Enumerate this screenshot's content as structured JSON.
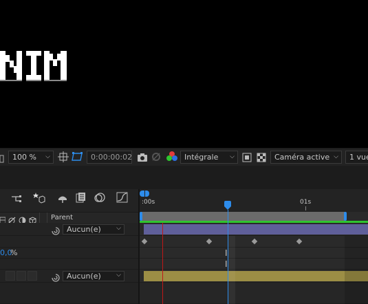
{
  "viewer": {
    "comp_text": "NIM"
  },
  "viewer_toolbar": {
    "zoom": "100 %",
    "timecode": "0:00:00:02",
    "resolution": "Intégrale",
    "camera": "Caméra active",
    "views": "1 vue"
  },
  "timeline": {
    "ruler": {
      "start_label": ":00s",
      "mark_label": "01s"
    },
    "columns": {
      "parent_label": "Parent"
    },
    "layers": [
      {
        "parent_value": "Aucun(e)",
        "bar_color": "#5f5f9a"
      },
      {
        "parent_value": "Aucun(e)",
        "bar_color": "#9c8e45"
      }
    ],
    "property_value": "0,0 %",
    "property_unit": "%",
    "property_number": "0,0"
  },
  "colors": {
    "accent_blue": "#2d8ceb",
    "work_area_green": "#2fc52f",
    "layer1_bar": "#5f5f9a",
    "layer2_bar": "#9c8e45",
    "cti_red": "#c01818"
  }
}
